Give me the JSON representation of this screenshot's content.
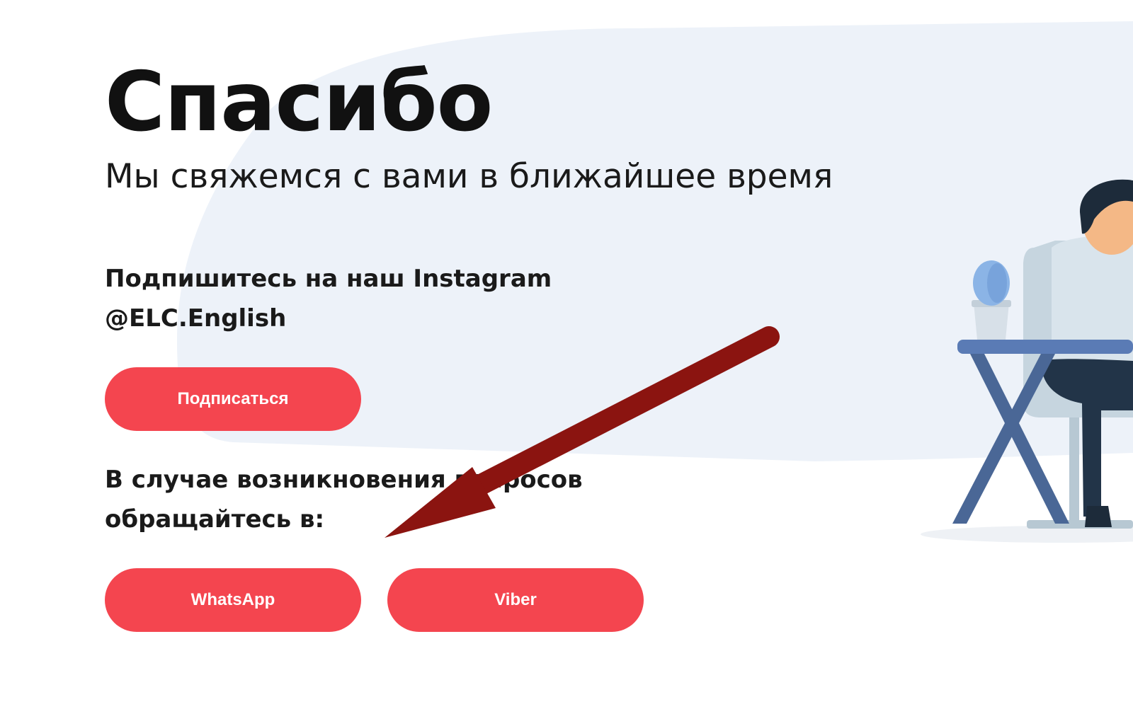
{
  "main": {
    "title": "Спасибо",
    "subtitle": "Мы свяжемся с вами в ближайшее время",
    "instagram_line1": "Подпишитесь на наш Instagram",
    "instagram_handle": "@ELC.English",
    "subscribe_label": "Подписаться",
    "contact_line1": "В случае возникновения вопросов",
    "contact_line2": "обращайтесь в:",
    "whatsapp_label": "WhatsApp",
    "viber_label": "Viber"
  },
  "colors": {
    "accent": "#f4454f",
    "background_blob": "#edf2f9",
    "arrow": "#8b1410",
    "text": "#111111"
  },
  "icons": {
    "illustration": "person-at-desk-illustration",
    "annotation": "arrow-annotation"
  }
}
